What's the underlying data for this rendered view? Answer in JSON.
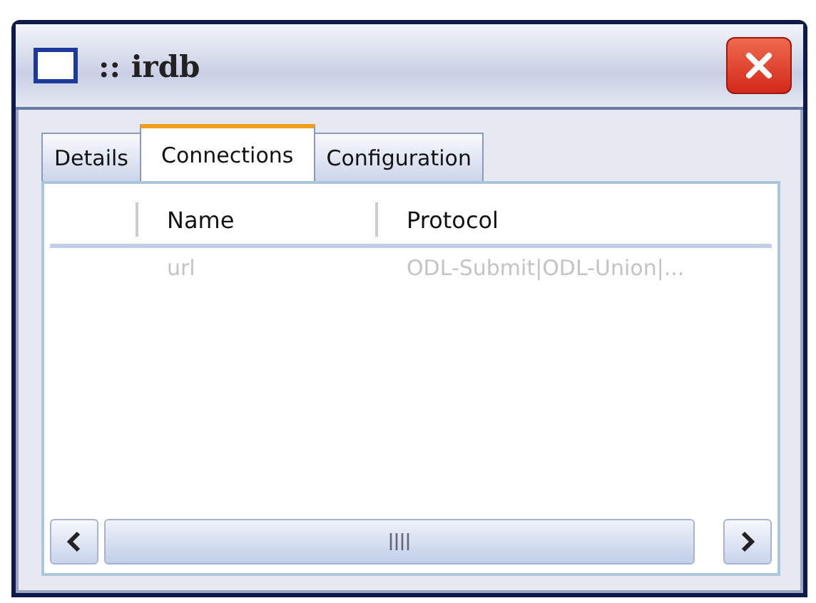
{
  "window": {
    "title": ":: irdb"
  },
  "tabs": [
    {
      "label": "Details",
      "selected": false
    },
    {
      "label": "Connections",
      "selected": true
    },
    {
      "label": "Configuration",
      "selected": false
    }
  ],
  "table": {
    "columns": [
      "Name",
      "Protocol"
    ],
    "rows": [
      {
        "cells": [
          "url",
          "ODL-Submit|ODL-Union|..."
        ],
        "disabled": true
      }
    ]
  }
}
